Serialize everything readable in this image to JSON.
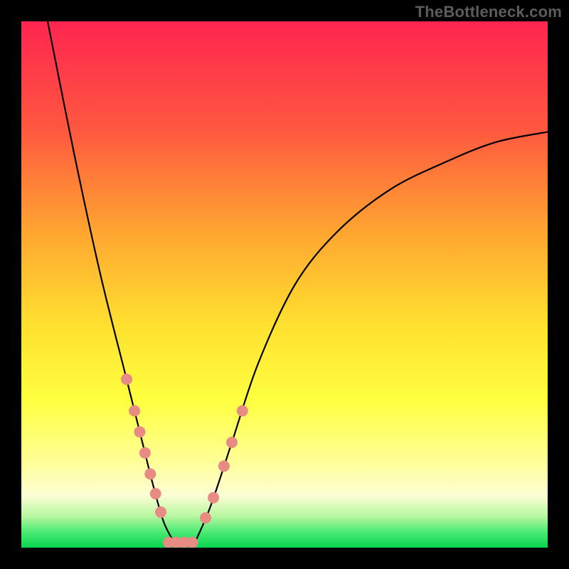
{
  "watermark": "TheBottleneck.com",
  "chart_data": {
    "type": "line",
    "title": "",
    "xlabel": "",
    "ylabel": "",
    "xlim": [
      0,
      100
    ],
    "ylim": [
      0,
      100
    ],
    "curves": {
      "left": {
        "description": "steep descending curve from top-left toward valley",
        "points": [
          {
            "x": 5,
            "y": 100
          },
          {
            "x": 10,
            "y": 75
          },
          {
            "x": 15,
            "y": 52
          },
          {
            "x": 20,
            "y": 32
          },
          {
            "x": 23,
            "y": 20
          },
          {
            "x": 25,
            "y": 12
          },
          {
            "x": 27,
            "y": 5
          },
          {
            "x": 29,
            "y": 1
          }
        ]
      },
      "right": {
        "description": "ascending curve from valley toward upper-right, flattening",
        "points": [
          {
            "x": 33,
            "y": 1
          },
          {
            "x": 36,
            "y": 8
          },
          {
            "x": 40,
            "y": 20
          },
          {
            "x": 45,
            "y": 35
          },
          {
            "x": 52,
            "y": 50
          },
          {
            "x": 60,
            "y": 60
          },
          {
            "x": 70,
            "y": 68
          },
          {
            "x": 80,
            "y": 73
          },
          {
            "x": 90,
            "y": 77
          },
          {
            "x": 100,
            "y": 79
          }
        ]
      }
    },
    "valley_floor_y": 1,
    "dot_markers": {
      "color": "#e98b85",
      "radius_px": 8,
      "left_branch_x": [
        20.0,
        21.5,
        22.5,
        23.5,
        24.5,
        25.5,
        26.5
      ],
      "right_branch_x": [
        35.0,
        36.5,
        38.5,
        40.0,
        42.0
      ],
      "valley_x": [
        28.0,
        29.5,
        31.0,
        32.5
      ]
    },
    "gradient_stops": [
      {
        "pct": 0,
        "color": "#ff2550"
      },
      {
        "pct": 20,
        "color": "#ff5640"
      },
      {
        "pct": 40,
        "color": "#ffa531"
      },
      {
        "pct": 58,
        "color": "#ffe12f"
      },
      {
        "pct": 72,
        "color": "#ffff40"
      },
      {
        "pct": 84,
        "color": "#ffff9a"
      },
      {
        "pct": 90,
        "color": "#fdfed5"
      },
      {
        "pct": 94,
        "color": "#b8f7a0"
      },
      {
        "pct": 97,
        "color": "#4cea74"
      },
      {
        "pct": 100,
        "color": "#06d54e"
      }
    ]
  }
}
